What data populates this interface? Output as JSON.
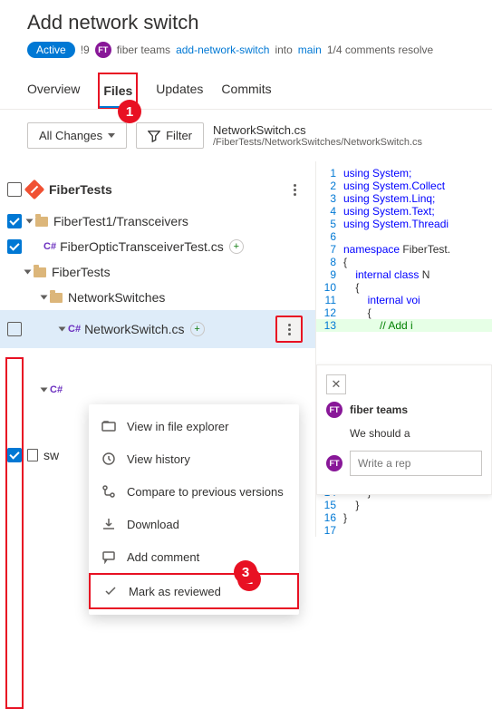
{
  "header": {
    "title": "Add network switch",
    "active_badge": "Active",
    "vote_count": "!9",
    "avatar_initials": "FT",
    "team_name": "fiber teams",
    "source_branch": "add-network-switch",
    "into_word": "into",
    "target_branch": "main",
    "comments_status": "1/4 comments resolve"
  },
  "tabs": {
    "overview": "Overview",
    "files": "Files",
    "updates": "Updates",
    "commits": "Commits"
  },
  "toolbar": {
    "all_changes": "All Changes",
    "filter": "Filter",
    "file_name": "NetworkSwitch.cs",
    "file_path": "/FiberTests/NetworkSwitches/NetworkSwitch.cs"
  },
  "tree": {
    "root": "FiberTests",
    "folder1": "FiberTest1/Transceivers",
    "file1": "FiberOpticTransceiverTest.cs",
    "folder2": "FiberTests",
    "folder3": "NetworkSwitches",
    "file2": "NetworkSwitch.cs",
    "file3_prefix": "C#",
    "file4": "sw"
  },
  "context_menu": {
    "view_explorer": "View in file explorer",
    "view_history": "View history",
    "compare": "Compare to previous versions",
    "download": "Download",
    "add_comment": "Add comment",
    "mark_reviewed": "Mark as reviewed"
  },
  "code": {
    "l1": "using System;",
    "l2": "using System.Collect",
    "l3": "using System.Linq;",
    "l4": "using System.Text;",
    "l5": "using System.Threadi",
    "l7a": "namespace",
    "l7b": " FiberTest.",
    "l8": "{",
    "l9a": "    internal",
    "l9b": " class",
    "l9c": " N",
    "l10": "    {",
    "l11a": "        internal",
    "l11b": " voi",
    "l12": "        {",
    "l13": "            // Add i",
    "l14": "        }",
    "l15": "    }",
    "l16": "}"
  },
  "comments": {
    "author": "fiber teams",
    "text": "We should a",
    "reply_placeholder": "Write a rep",
    "avatar": "FT"
  }
}
